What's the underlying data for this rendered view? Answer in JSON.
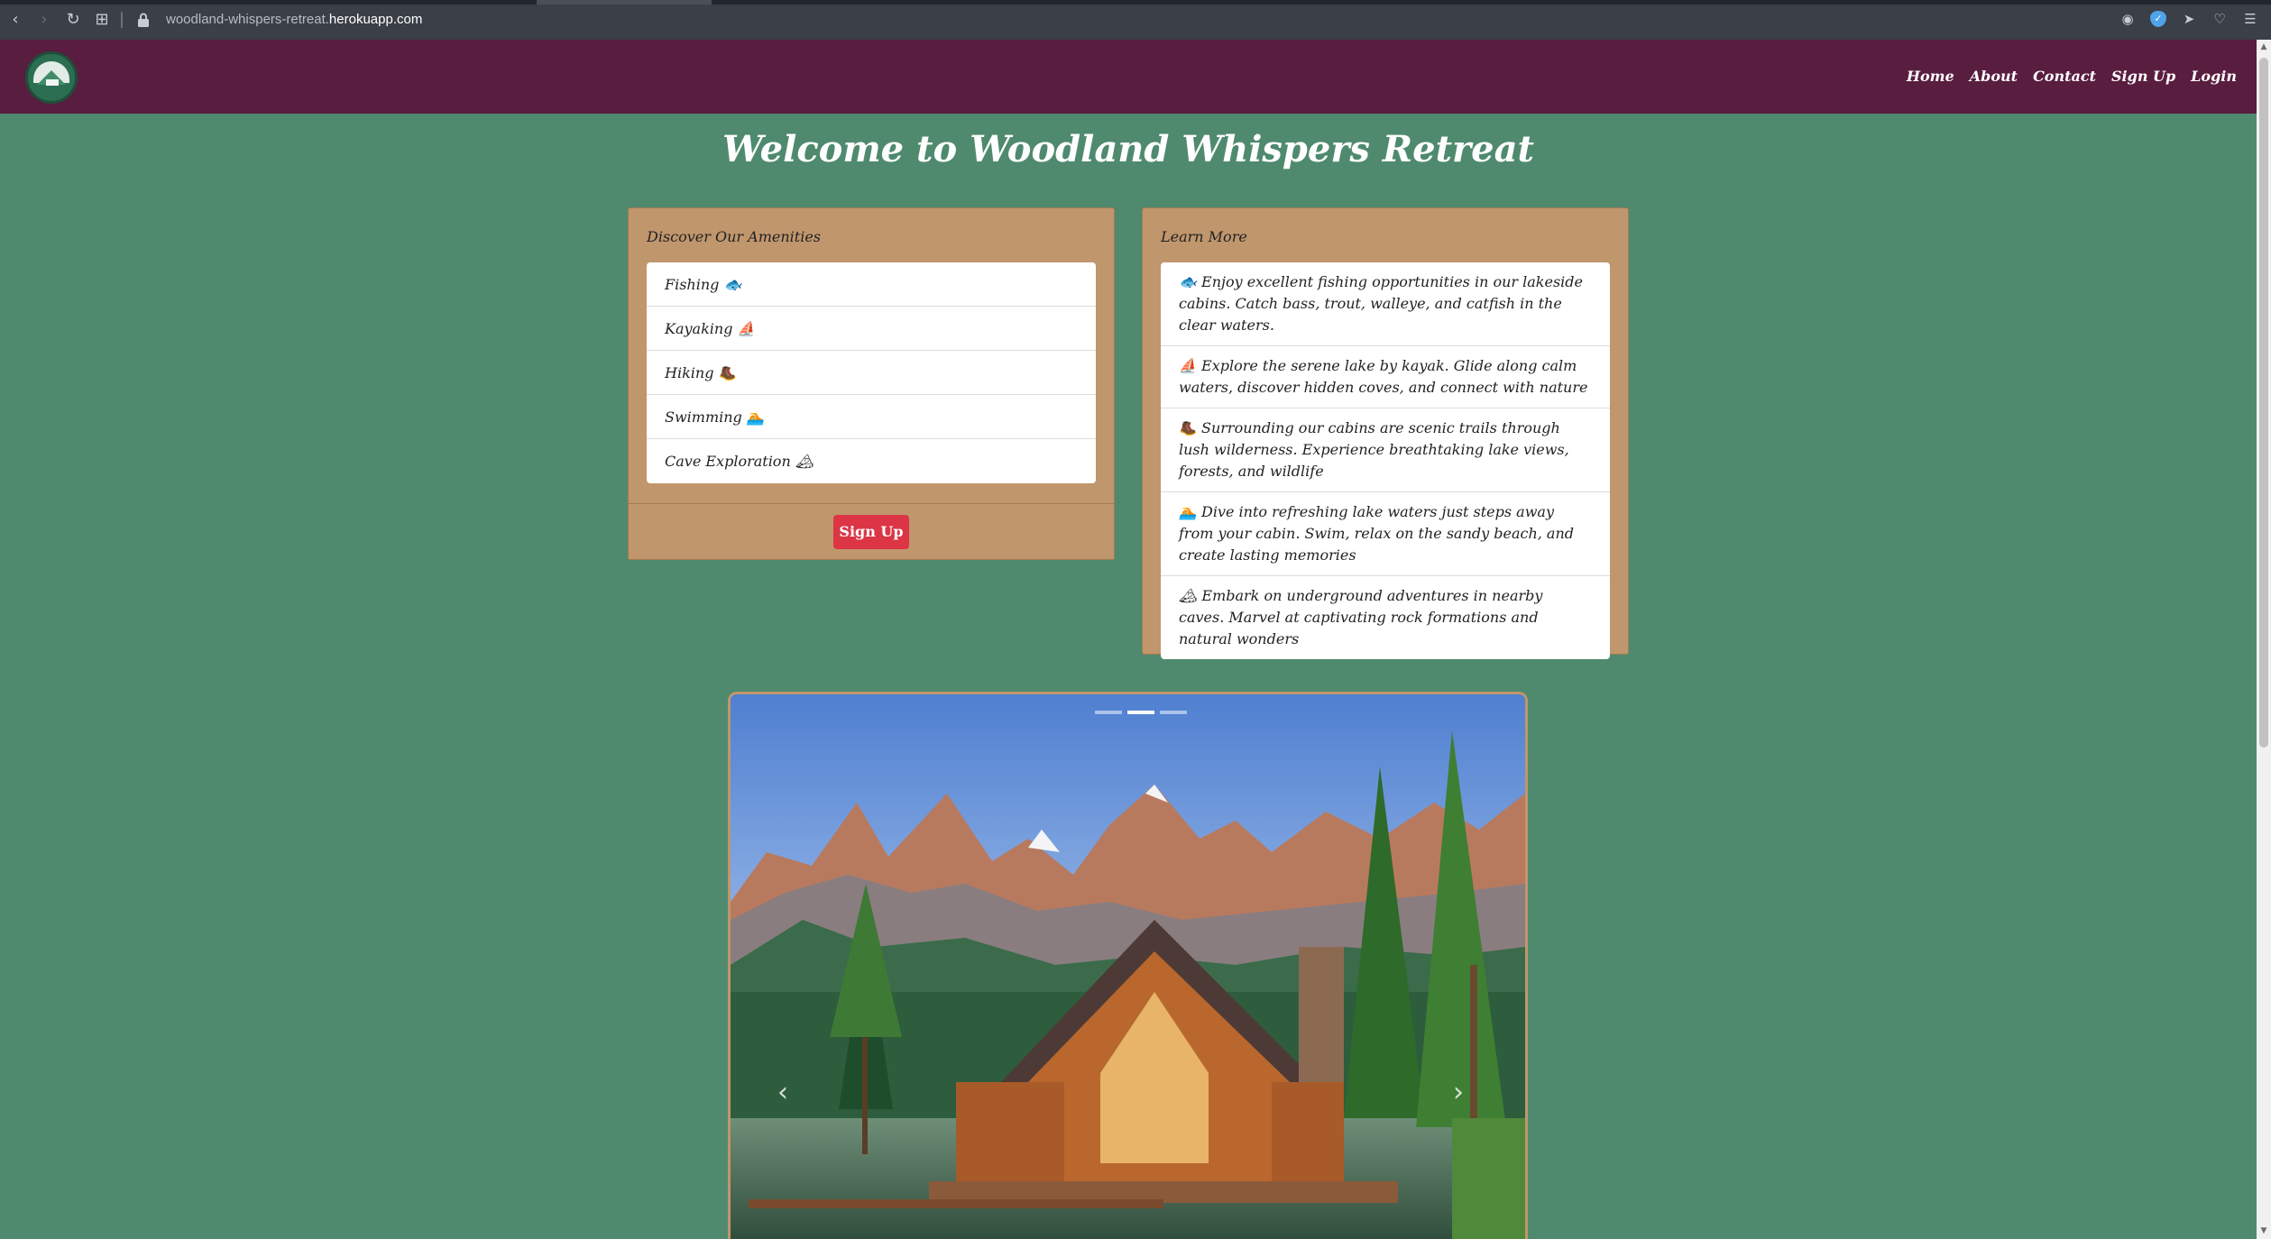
{
  "browser": {
    "url_prefix": "woodland-whispers-retreat.",
    "url_domain": "herokuapp.com",
    "back_icon": "‹",
    "forward_icon": "›",
    "reload_icon": "↻",
    "tabs_icon": "⊞"
  },
  "navbar": {
    "links": [
      "Home",
      "About",
      "Contact",
      "Sign Up",
      "Login"
    ],
    "brand_color": "#591d3f"
  },
  "page": {
    "title": "Welcome to Woodland Whispers Retreat",
    "background": "#4f8a6e"
  },
  "amenities": {
    "header": "Discover Our Amenities",
    "items": [
      "Fishing 🐟",
      "Kayaking ⛵",
      "Hiking 🥾",
      "Swimming 🏊",
      "Cave Exploration 🏔"
    ],
    "button_label": "Sign Up",
    "button_color": "#dc3545"
  },
  "learn_more": {
    "header": "Learn More",
    "items": [
      "🐟 Enjoy excellent fishing opportunities in our lakeside cabins. Catch bass, trout, walleye, and catfish in the clear waters.",
      "⛵ Explore the serene lake by kayak. Glide along calm waters, discover hidden coves, and connect with nature",
      "🥾 Surrounding our cabins are scenic trails through lush wilderness. Experience breathtaking lake views, forests, and wildlife",
      "🏊 Dive into refreshing lake waters just steps away from your cabin. Swim, relax on the sandy beach, and create lasting memories",
      "🏔 Embark on underground adventures in nearby caves. Marvel at captivating rock formations and natural wonders"
    ]
  },
  "carousel": {
    "prev_icon": "‹",
    "next_icon": "›",
    "slide_count": 3,
    "active_index": 1
  }
}
